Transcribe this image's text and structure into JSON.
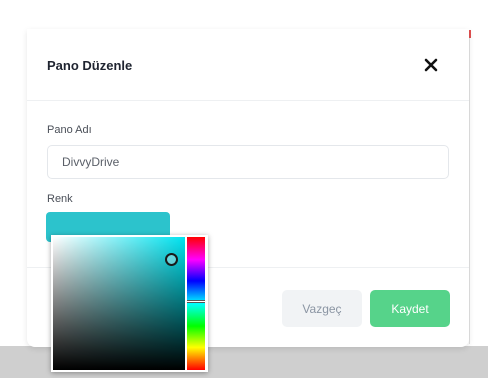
{
  "dialog": {
    "title": "Pano Düzenle",
    "close_icon": "close-icon"
  },
  "form": {
    "name_label": "Pano Adı",
    "name_value": "DivvyDrive",
    "color_label": "Renk",
    "color_value": "#2cc3cc"
  },
  "color_picker": {
    "hue_color": "#00e3f0"
  },
  "footer": {
    "cancel_label": "Vazgeç",
    "save_label": "Kaydet"
  },
  "colors": {
    "accent_save": "#56d38a",
    "cancel_bg": "#f1f3f5"
  }
}
